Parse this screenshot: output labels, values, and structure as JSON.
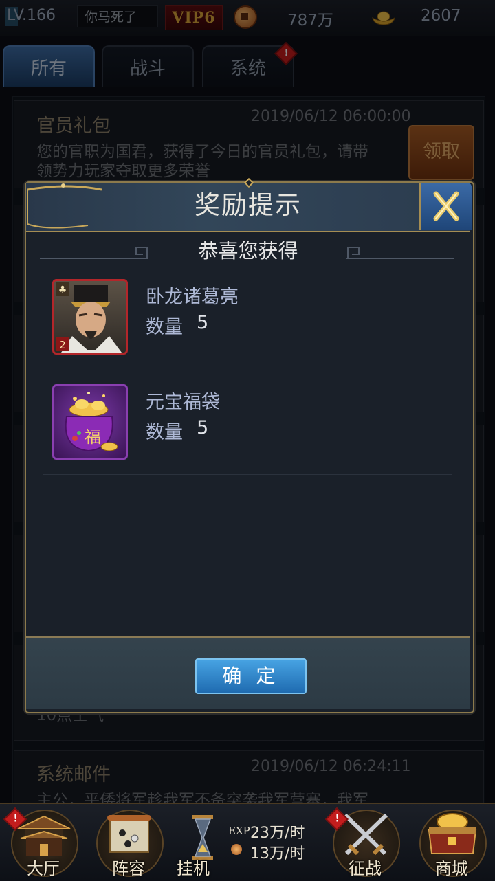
{
  "topbar": {
    "level": "LV.166",
    "player_name": "你马死了",
    "vip": "VIP6",
    "coins": "787万",
    "gold": "2607"
  },
  "tabs": [
    {
      "label": "所有",
      "active": true
    },
    {
      "label": "战斗",
      "active": false
    },
    {
      "label": "系统",
      "active": false,
      "badge": "!"
    }
  ],
  "mails": [
    {
      "title": "官员礼包",
      "date": "2019/06/12 06:00:00",
      "body_line1": "您的官职为国君，获得了今日的官员礼包，请带",
      "body_line2": "领势力玩家夺取更多荣誉",
      "claim_label": "领取"
    },
    {
      "partial_text": "10点士气"
    },
    {
      "title": "系统邮件",
      "date": "2019/06/12 06:24:11",
      "body_line1": "主公，平倭将军趁我军不备突袭我军营寨，我军"
    }
  ],
  "dialog": {
    "title": "奖励提示",
    "subtitle": "恭喜您获得",
    "qty_label": "数量",
    "items": [
      {
        "name": "卧龙诸葛亮",
        "quantity": "5",
        "icon": "hero-portrait-icon",
        "frame_color": "#b3262a"
      },
      {
        "name": "元宝福袋",
        "quantity": "5",
        "icon": "lucky-bag-icon",
        "frame_color": "#8a3fb0"
      }
    ],
    "confirm_label": "确 定"
  },
  "bottom_nav": [
    {
      "label": "大厅",
      "icon": "palace-icon",
      "badge": "!"
    },
    {
      "label": "阵容",
      "icon": "scroll-icon"
    },
    {
      "label": "挂机",
      "icon": "hourglass-icon"
    },
    {
      "label": "征战",
      "icon": "crossed-swords-icon",
      "badge": "!"
    },
    {
      "label": "商城",
      "icon": "treasure-chest-icon"
    }
  ],
  "idle_rates": {
    "exp_label": "EXP",
    "exp_rate": "23万/时",
    "coin_rate": "13万/时"
  },
  "colors": {
    "accent_blue": "#3c6aa1",
    "gold_border": "#a58d53",
    "confirm_button": "#2f88cf",
    "badge_red": "#c31d1d"
  }
}
